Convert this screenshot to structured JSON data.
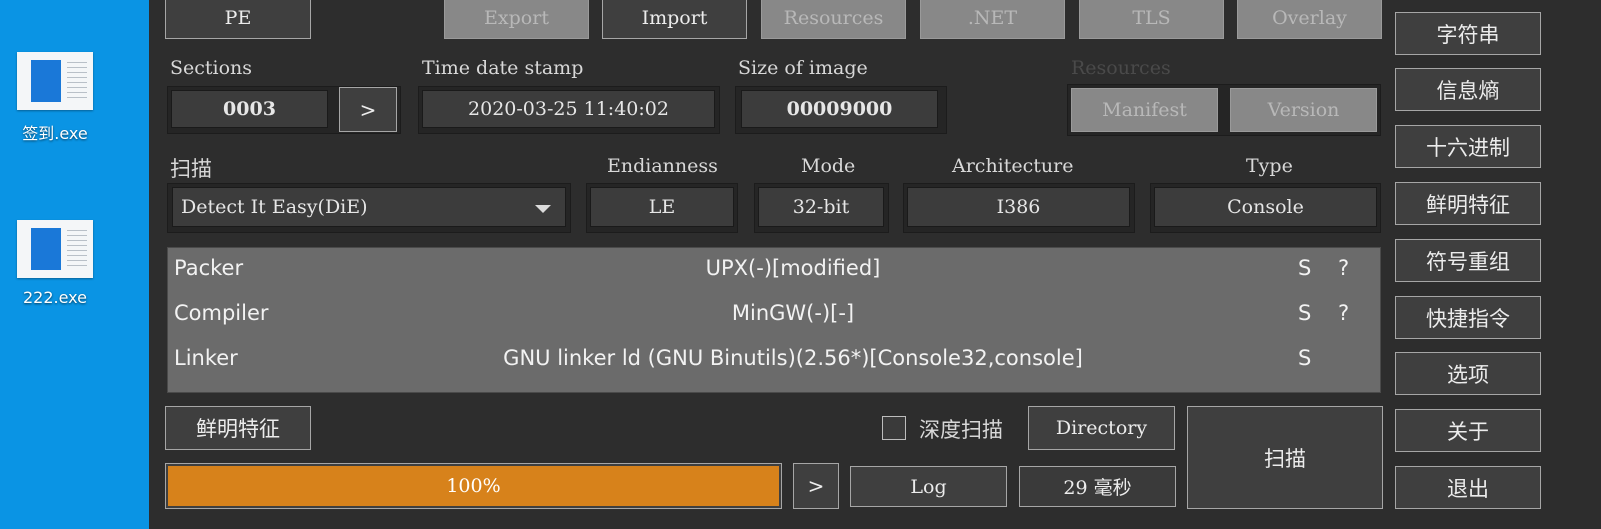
{
  "desktop": {
    "icons": [
      {
        "label": "签到.exe"
      },
      {
        "label": "222.exe"
      }
    ]
  },
  "toolbar": {
    "pe": "PE",
    "tabs": [
      "Export",
      "Import",
      "Resources",
      ".NET",
      "TLS",
      "Overlay"
    ]
  },
  "sections": {
    "label": "Sections",
    "value": "0003",
    "arrow": ">"
  },
  "timestamp": {
    "label": "Time date stamp",
    "value": "2020-03-25 11:40:02"
  },
  "size_of_image": {
    "label": "Size of image",
    "value": "00009000"
  },
  "resources": {
    "label": "Resources",
    "manifest": "Manifest",
    "version": "Version"
  },
  "scan": {
    "label": "扫描",
    "engine": "Detect It Easy(DiE)"
  },
  "endianness": {
    "label": "Endianness",
    "value": "LE"
  },
  "mode": {
    "label": "Mode",
    "value": "32-bit"
  },
  "architecture": {
    "label": "Architecture",
    "value": "I386"
  },
  "type": {
    "label": "Type",
    "value": "Console"
  },
  "results": [
    {
      "kind": "Packer",
      "name": "UPX(-)[modified]",
      "s": "S",
      "q": "?"
    },
    {
      "kind": "Compiler",
      "name": "MinGW(-)[-]",
      "s": "S",
      "q": "?"
    },
    {
      "kind": "Linker",
      "name": "GNU linker ld (GNU Binutils)(2.56*)[Console32,console]",
      "s": "S",
      "q": ""
    }
  ],
  "bottom": {
    "signatures_button": "鲜明特征",
    "deep_scan_label": "深度扫描",
    "directory_button": "Directory",
    "progress_text": "100%",
    "progress_value": 100,
    "arrow": ">",
    "log_button": "Log",
    "elapsed": "29 毫秒",
    "scan_button": "扫描"
  },
  "sidebar": {
    "items": [
      "字符串",
      "信息熵",
      "十六进制",
      "鲜明特征",
      "符号重组",
      "快捷指令",
      "选项",
      "关于",
      "退出"
    ]
  },
  "colors": {
    "accent": "#d7821b",
    "desktop": "#0a94e4",
    "window": "#2d2d2d"
  }
}
